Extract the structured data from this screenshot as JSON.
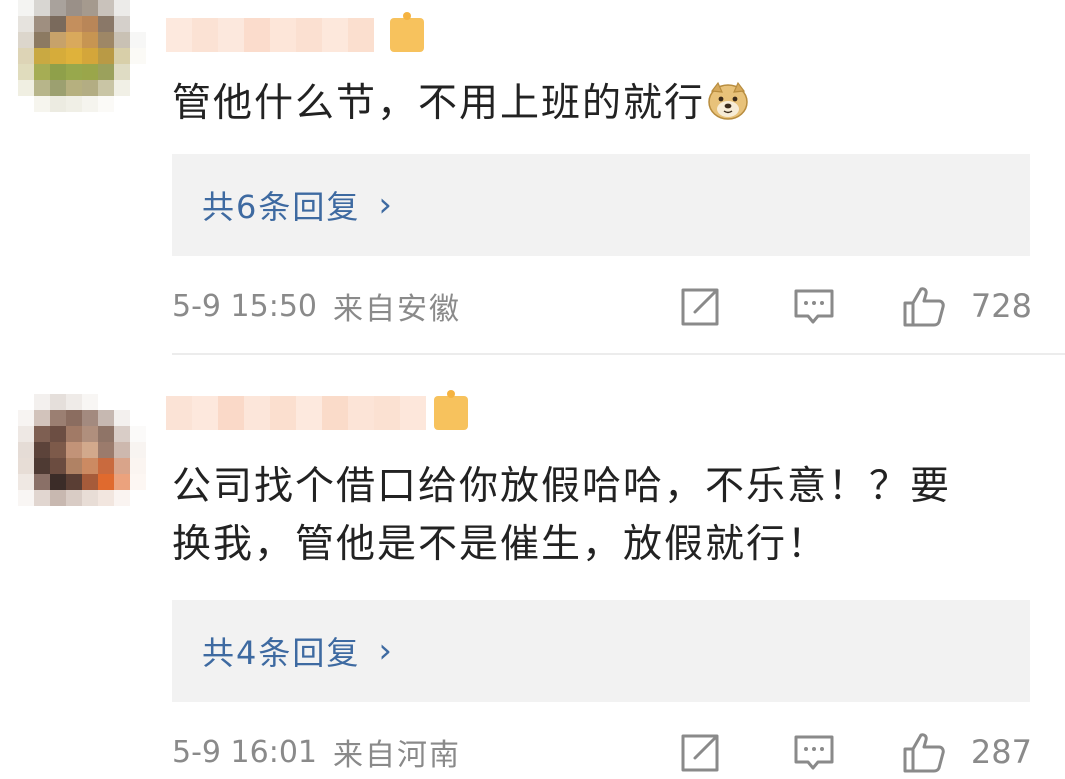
{
  "colors": {
    "link": "#3e6aa1",
    "meta_gray": "#8a8a8a",
    "text": "#222222",
    "reply_bg": "#f2f2f2",
    "badge": "#f7c25d"
  },
  "comments": [
    {
      "text": "管他什么节，不用上班的就行",
      "emoji": "doge-emoji-icon",
      "reply_label": "共6条回复",
      "reply_chevron": "›",
      "time": "5-9 15:50",
      "location": "来自安徽",
      "likes": "728",
      "icons": [
        "repost-icon",
        "comment-icon",
        "like-icon"
      ]
    },
    {
      "text_line1": "公司找个借口给你放假哈哈，不乐意！？要",
      "text_line2": "换我，管他是不是催生，放假就行！",
      "reply_label": "共4条回复",
      "reply_chevron": "›",
      "time": "5-9 16:01",
      "location": "来自河南",
      "likes": "287",
      "icons": [
        "repost-icon",
        "comment-icon",
        "like-icon"
      ]
    }
  ]
}
